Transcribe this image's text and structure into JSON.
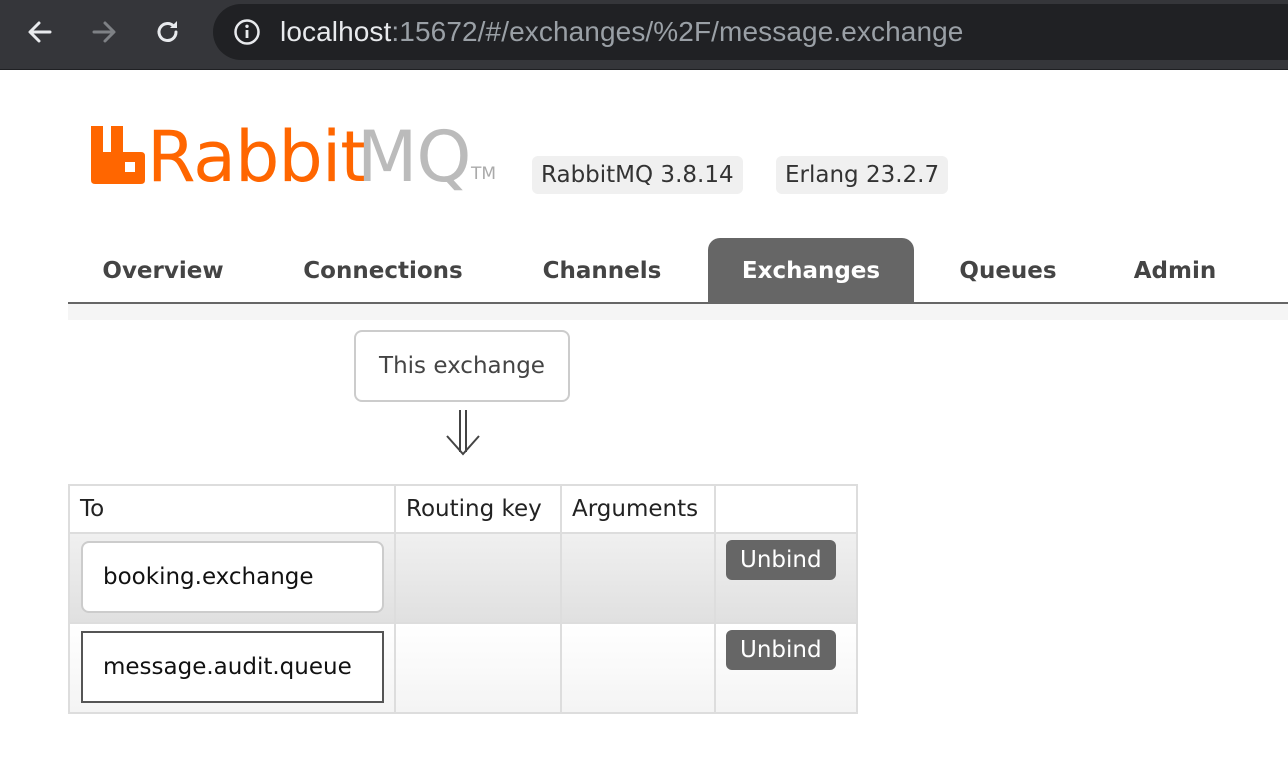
{
  "browser": {
    "url_host": "localhost",
    "url_rest": ":15672/#/exchanges/%2F/message.exchange",
    "back_icon": "arrow-left-icon",
    "forward_icon": "arrow-right-icon",
    "reload_icon": "reload-icon",
    "info_icon": "info-icon"
  },
  "header": {
    "logo_word_orange": "Rabbit",
    "logo_word_grey": "MQ",
    "logo_tm": "TM",
    "rabbitmq_version": "RabbitMQ 3.8.14",
    "erlang_version": "Erlang 23.2.7",
    "brand_color": "#ff6600"
  },
  "tabs": [
    {
      "label": "Overview",
      "active": false
    },
    {
      "label": "Connections",
      "active": false
    },
    {
      "label": "Channels",
      "active": false
    },
    {
      "label": "Exchanges",
      "active": true
    },
    {
      "label": "Queues",
      "active": false
    },
    {
      "label": "Admin",
      "active": false
    }
  ],
  "bindings": {
    "source_label": "This exchange",
    "columns": [
      "To",
      "Routing key",
      "Arguments",
      ""
    ],
    "rows": [
      {
        "to": "booking.exchange",
        "type": "exchange",
        "routing_key": "",
        "arguments": "",
        "action": "Unbind"
      },
      {
        "to": "message.audit.queue",
        "type": "queue",
        "routing_key": "",
        "arguments": "",
        "action": "Unbind"
      }
    ]
  }
}
